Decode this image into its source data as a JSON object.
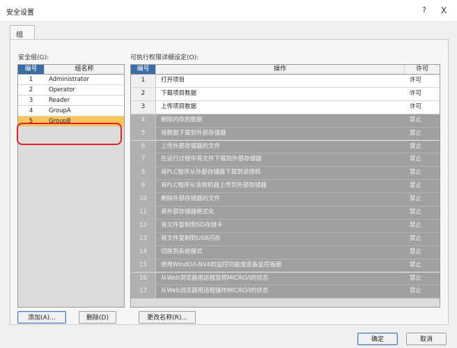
{
  "window": {
    "title": "安全设置",
    "help": "?",
    "close": "X"
  },
  "tab": {
    "label": "组"
  },
  "groups": {
    "label": "安全组(G):",
    "col_num": "编号",
    "col_name": "组名称",
    "rows": [
      {
        "num": "1",
        "name": "Administrator"
      },
      {
        "num": "2",
        "name": "Operator"
      },
      {
        "num": "3",
        "name": "Reader"
      },
      {
        "num": "4",
        "name": "GroupA"
      },
      {
        "num": "5",
        "name": "GroupB"
      }
    ]
  },
  "perms": {
    "label": "可执行权限详细设定(O):",
    "col_num": "编号",
    "col_op": "操作",
    "col_perm": "许可",
    "rows": [
      {
        "num": "1",
        "op": "打开项目",
        "perm": "许可",
        "allowed": true
      },
      {
        "num": "2",
        "op": "下载项目数据",
        "perm": "许可",
        "allowed": true
      },
      {
        "num": "3",
        "op": "上传项目数据",
        "perm": "许可",
        "allowed": true
      },
      {
        "num": "4",
        "op": "删除内存的数据",
        "perm": "禁止",
        "allowed": false
      },
      {
        "num": "5",
        "op": "将数据下载到外部存储器",
        "perm": "禁止",
        "allowed": false
      },
      {
        "num": "6",
        "op": "上传外部存储器的文件",
        "perm": "禁止",
        "allowed": false
      },
      {
        "num": "7",
        "op": "在运行过程中将文件下载到外部存储器",
        "perm": "禁止",
        "allowed": false
      },
      {
        "num": "8",
        "op": "将PLC程序从外部存储器下载到该侧机",
        "perm": "禁止",
        "allowed": false
      },
      {
        "num": "9",
        "op": "将PLC程序从该侧机器上传到外部存储器",
        "perm": "禁止",
        "allowed": false
      },
      {
        "num": "10",
        "op": "删除外部存储器的文件",
        "perm": "禁止",
        "allowed": false
      },
      {
        "num": "11",
        "op": "将外部存储器格式化",
        "perm": "禁止",
        "allowed": false
      },
      {
        "num": "12",
        "op": "将文件复制到SD存储卡",
        "perm": "禁止",
        "allowed": false
      },
      {
        "num": "13",
        "op": "将文件复制到USB闪存",
        "perm": "禁止",
        "allowed": false
      },
      {
        "num": "14",
        "op": "切换到系统模式",
        "perm": "禁止",
        "allowed": false
      },
      {
        "num": "15",
        "op": "使用WindO/I-NV4的监控功能或设备监控画面",
        "perm": "禁止",
        "allowed": false
      },
      {
        "num": "16",
        "op": "从Web浏览器用远程监视MICRO/I的状态",
        "perm": "禁止",
        "allowed": false
      },
      {
        "num": "17",
        "op": "从Web浏览器用远程操作MICRO/I的状态",
        "perm": "禁止",
        "allowed": false
      }
    ]
  },
  "buttons": {
    "add": "添加(A)...",
    "delete": "删除(D)",
    "rename": "更改名称(R)...",
    "ok": "确定",
    "cancel": "取消"
  },
  "colors": {
    "selection": "#f7c55b",
    "highlight_ring": "#e0212a",
    "header_selected": "#3a6da5",
    "denied_row": "#a0a0a0"
  }
}
